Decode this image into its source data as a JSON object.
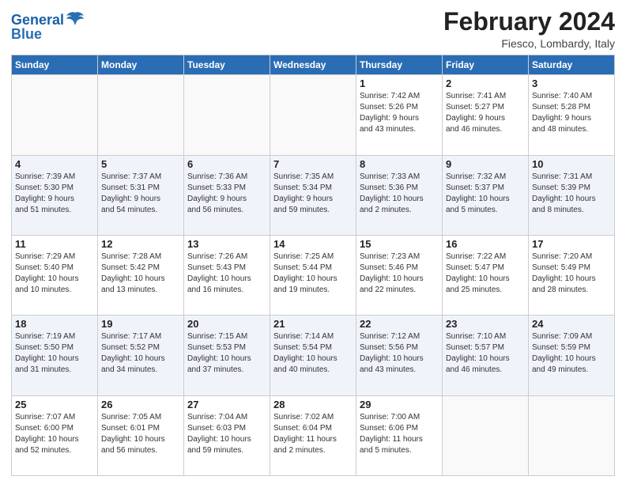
{
  "header": {
    "logo_general": "General",
    "logo_blue": "Blue",
    "title": "February 2024",
    "subtitle": "Fiesco, Lombardy, Italy"
  },
  "weekdays": [
    "Sunday",
    "Monday",
    "Tuesday",
    "Wednesday",
    "Thursday",
    "Friday",
    "Saturday"
  ],
  "weeks": [
    [
      {
        "day": "",
        "info": ""
      },
      {
        "day": "",
        "info": ""
      },
      {
        "day": "",
        "info": ""
      },
      {
        "day": "",
        "info": ""
      },
      {
        "day": "1",
        "info": "Sunrise: 7:42 AM\nSunset: 5:26 PM\nDaylight: 9 hours\nand 43 minutes."
      },
      {
        "day": "2",
        "info": "Sunrise: 7:41 AM\nSunset: 5:27 PM\nDaylight: 9 hours\nand 46 minutes."
      },
      {
        "day": "3",
        "info": "Sunrise: 7:40 AM\nSunset: 5:28 PM\nDaylight: 9 hours\nand 48 minutes."
      }
    ],
    [
      {
        "day": "4",
        "info": "Sunrise: 7:39 AM\nSunset: 5:30 PM\nDaylight: 9 hours\nand 51 minutes."
      },
      {
        "day": "5",
        "info": "Sunrise: 7:37 AM\nSunset: 5:31 PM\nDaylight: 9 hours\nand 54 minutes."
      },
      {
        "day": "6",
        "info": "Sunrise: 7:36 AM\nSunset: 5:33 PM\nDaylight: 9 hours\nand 56 minutes."
      },
      {
        "day": "7",
        "info": "Sunrise: 7:35 AM\nSunset: 5:34 PM\nDaylight: 9 hours\nand 59 minutes."
      },
      {
        "day": "8",
        "info": "Sunrise: 7:33 AM\nSunset: 5:36 PM\nDaylight: 10 hours\nand 2 minutes."
      },
      {
        "day": "9",
        "info": "Sunrise: 7:32 AM\nSunset: 5:37 PM\nDaylight: 10 hours\nand 5 minutes."
      },
      {
        "day": "10",
        "info": "Sunrise: 7:31 AM\nSunset: 5:39 PM\nDaylight: 10 hours\nand 8 minutes."
      }
    ],
    [
      {
        "day": "11",
        "info": "Sunrise: 7:29 AM\nSunset: 5:40 PM\nDaylight: 10 hours\nand 10 minutes."
      },
      {
        "day": "12",
        "info": "Sunrise: 7:28 AM\nSunset: 5:42 PM\nDaylight: 10 hours\nand 13 minutes."
      },
      {
        "day": "13",
        "info": "Sunrise: 7:26 AM\nSunset: 5:43 PM\nDaylight: 10 hours\nand 16 minutes."
      },
      {
        "day": "14",
        "info": "Sunrise: 7:25 AM\nSunset: 5:44 PM\nDaylight: 10 hours\nand 19 minutes."
      },
      {
        "day": "15",
        "info": "Sunrise: 7:23 AM\nSunset: 5:46 PM\nDaylight: 10 hours\nand 22 minutes."
      },
      {
        "day": "16",
        "info": "Sunrise: 7:22 AM\nSunset: 5:47 PM\nDaylight: 10 hours\nand 25 minutes."
      },
      {
        "day": "17",
        "info": "Sunrise: 7:20 AM\nSunset: 5:49 PM\nDaylight: 10 hours\nand 28 minutes."
      }
    ],
    [
      {
        "day": "18",
        "info": "Sunrise: 7:19 AM\nSunset: 5:50 PM\nDaylight: 10 hours\nand 31 minutes."
      },
      {
        "day": "19",
        "info": "Sunrise: 7:17 AM\nSunset: 5:52 PM\nDaylight: 10 hours\nand 34 minutes."
      },
      {
        "day": "20",
        "info": "Sunrise: 7:15 AM\nSunset: 5:53 PM\nDaylight: 10 hours\nand 37 minutes."
      },
      {
        "day": "21",
        "info": "Sunrise: 7:14 AM\nSunset: 5:54 PM\nDaylight: 10 hours\nand 40 minutes."
      },
      {
        "day": "22",
        "info": "Sunrise: 7:12 AM\nSunset: 5:56 PM\nDaylight: 10 hours\nand 43 minutes."
      },
      {
        "day": "23",
        "info": "Sunrise: 7:10 AM\nSunset: 5:57 PM\nDaylight: 10 hours\nand 46 minutes."
      },
      {
        "day": "24",
        "info": "Sunrise: 7:09 AM\nSunset: 5:59 PM\nDaylight: 10 hours\nand 49 minutes."
      }
    ],
    [
      {
        "day": "25",
        "info": "Sunrise: 7:07 AM\nSunset: 6:00 PM\nDaylight: 10 hours\nand 52 minutes."
      },
      {
        "day": "26",
        "info": "Sunrise: 7:05 AM\nSunset: 6:01 PM\nDaylight: 10 hours\nand 56 minutes."
      },
      {
        "day": "27",
        "info": "Sunrise: 7:04 AM\nSunset: 6:03 PM\nDaylight: 10 hours\nand 59 minutes."
      },
      {
        "day": "28",
        "info": "Sunrise: 7:02 AM\nSunset: 6:04 PM\nDaylight: 11 hours\nand 2 minutes."
      },
      {
        "day": "29",
        "info": "Sunrise: 7:00 AM\nSunset: 6:06 PM\nDaylight: 11 hours\nand 5 minutes."
      },
      {
        "day": "",
        "info": ""
      },
      {
        "day": "",
        "info": ""
      }
    ]
  ]
}
